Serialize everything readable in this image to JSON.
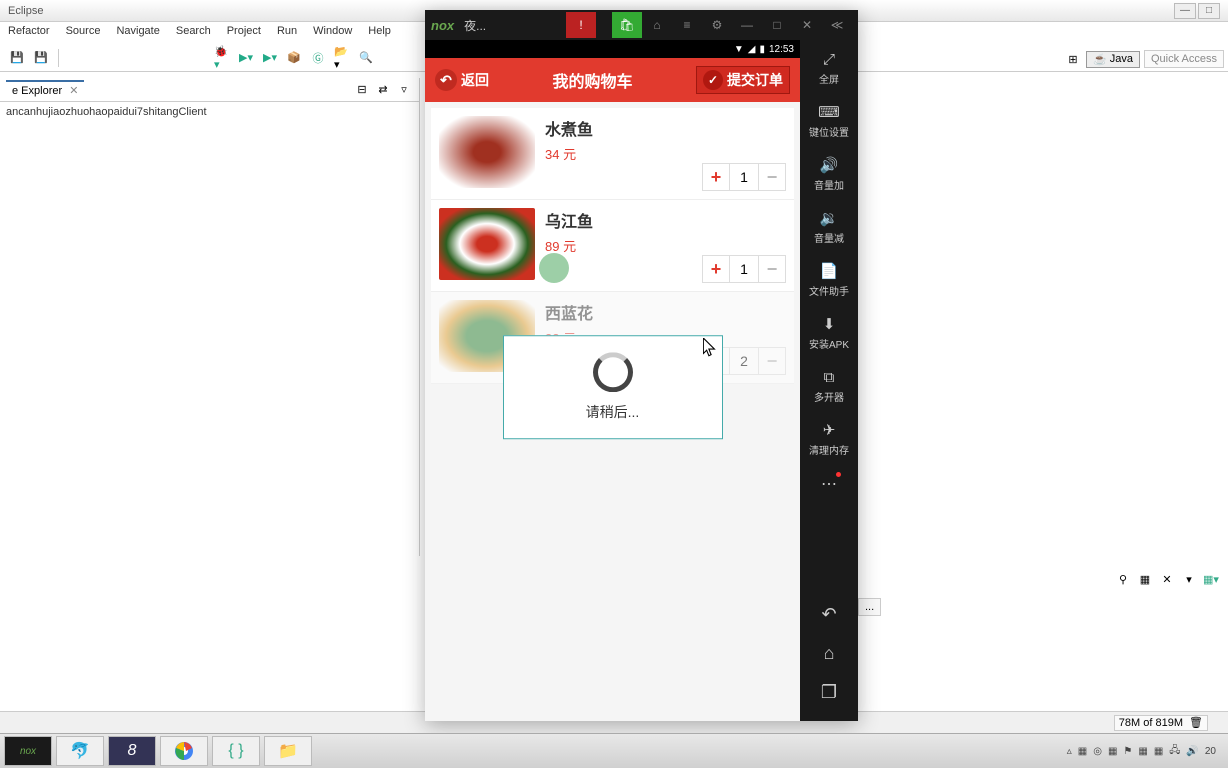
{
  "eclipse": {
    "title": "Eclipse",
    "menu": [
      "Refactor",
      "Source",
      "Navigate",
      "Search",
      "Project",
      "Run",
      "Window",
      "Help"
    ],
    "explorer_tab": "e Explorer",
    "project_name": "ancanhujiaozhuohaopaidui7shitangClient",
    "perspective": "Java",
    "quick_access": "Quick Access",
    "memory": "78M of 819M",
    "console_label": "..."
  },
  "nox": {
    "logo": "nox",
    "app_name": "夜...",
    "sidebar": [
      {
        "icon": "⤢",
        "label": "全屏"
      },
      {
        "icon": "⌨",
        "label": "键位设置"
      },
      {
        "icon": "🔊+",
        "label": "音量加"
      },
      {
        "icon": "🔊−",
        "label": "音量减"
      },
      {
        "icon": "📄",
        "label": "文件助手"
      },
      {
        "icon": "⬇",
        "label": "安装APK"
      },
      {
        "icon": "⧉",
        "label": "多开器"
      },
      {
        "icon": "✈",
        "label": "清理内存"
      }
    ]
  },
  "android_status": {
    "wifi": "▼",
    "signal": "◢",
    "battery": "▮",
    "time": "12:53"
  },
  "app": {
    "back_label": "返回",
    "title": "我的购物车",
    "submit_label": "提交订单",
    "loading_text": "请稍后...",
    "items": [
      {
        "name": "水煮鱼",
        "price": "34 元",
        "qty": "1"
      },
      {
        "name": "乌江鱼",
        "price": "89 元",
        "qty": "1"
      },
      {
        "name": "西蓝花",
        "price": "32 元",
        "qty": "2"
      }
    ]
  },
  "taskbar": {
    "tray_time": "20"
  }
}
